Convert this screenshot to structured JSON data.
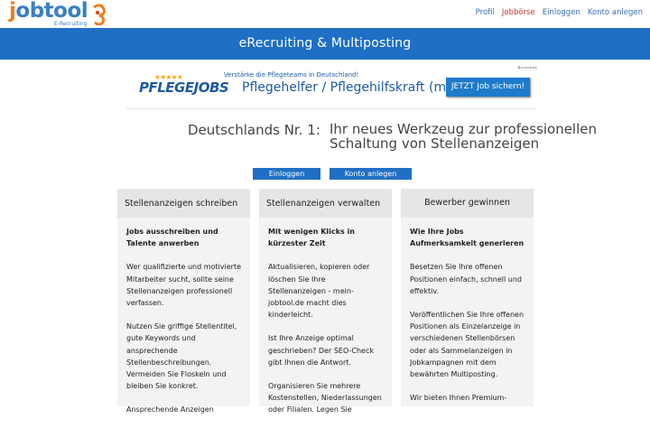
{
  "brand": {
    "logo_text_j": "j",
    "logo_text_rest": "obtool",
    "logo_sub": "E-Recruiting"
  },
  "nav": [
    {
      "label": "Profil",
      "active": false
    },
    {
      "label": "Jobbörse",
      "active": true
    },
    {
      "label": "Einloggen",
      "active": false
    },
    {
      "label": "Konto anlegen",
      "active": false
    }
  ],
  "hero": {
    "title": "eRecruiting & Multiposting"
  },
  "ad": {
    "label": "Anzeige",
    "stars": "★★★★★",
    "brand_a": "PFLEGE",
    "brand_b": "JOBS",
    "topline": "Verstärke die Pflegeteams in Deutschland!",
    "main": "Pflegehelfer / Pflegehilfskraft (m/w/d)",
    "cta": "JETZT Job sichern!"
  },
  "headline": {
    "left": "Deutschlands Nr. 1:",
    "right": "Ihr neues Werkzeug zur professionellen Schaltung von Stellenanzeigen"
  },
  "buttons": {
    "login": "Einloggen",
    "register": "Konto anlegen"
  },
  "columns": [
    {
      "title": "Stellenanzeigen schreiben",
      "lead": "Jobs ausschreiben und Talente anwerben",
      "paras": [
        "Wer qualifizierte und motivierte Mitarbeiter sucht, sollte seine Stellenanzeigen professionell verfassen.",
        "Nutzen Sie griffige Stellentitel, gute Keywords und ansprechende Stellenbeschreibungen. Vermeiden Sie Floskeln und bleiben Sie konkret.",
        "Ansprechende Anzeigen"
      ]
    },
    {
      "title": "Stellenanzeigen verwalten",
      "lead": "Mit wenigen Klicks in kürzester Zeit",
      "paras": [
        "Aktualisieren, kopieren oder löschen Sie Ihre Stellenanzeigen - mein-jobtool.de macht dies kinderleicht.",
        "Ist Ihre Anzeige optimal geschrieben? Der SEO-Check gibt Ihnen die Antwort.",
        "Organisieren Sie mehrere Kostenstellen, Niederlassungen oder Filialen. Legen Sie"
      ]
    },
    {
      "title": "Bewerber gewinnen",
      "lead": "Wie Ihre Jobs Aufmerksamkeit generieren",
      "paras": [
        "Besetzen Sie Ihre offenen Positionen einfach, schnell und effektiv.",
        "Veröffentlichen Sie Ihre offenen Positionen als Einzelanzeige in verschiedenen Stellenbörsen oder als Sammelanzeigen in Jobkampagnen mit dem bewährten Multiposting.",
        "Wir bieten Ihnen Premium-"
      ]
    }
  ],
  "colors": {
    "accent": "#1f6fc4",
    "brand_orange": "#f07c1b",
    "nav_active": "#d1332c"
  }
}
